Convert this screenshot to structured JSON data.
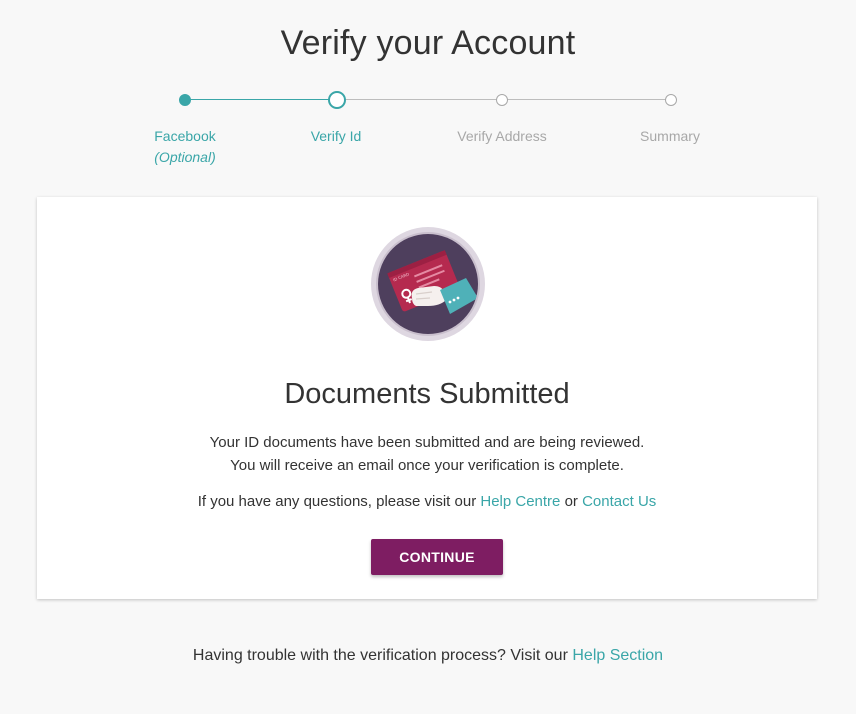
{
  "page": {
    "title": "Verify your Account"
  },
  "stepper": {
    "steps": [
      {
        "label": "Facebook",
        "sublabel": "(Optional)",
        "state": "complete"
      },
      {
        "label": "Verify Id",
        "state": "current"
      },
      {
        "label": "Verify Address",
        "state": "pending"
      },
      {
        "label": "Summary",
        "state": "pending"
      }
    ]
  },
  "card": {
    "illustration_icon": "id-card-in-hand-icon",
    "illustration_card_text": "ID CARD",
    "title": "Documents Submitted",
    "message_line1": "Your ID documents have been submitted and are being reviewed.",
    "message_line2": "You will receive an email once your verification is complete.",
    "help_prefix": "If you have any questions, please visit our",
    "help_centre_link": "Help Centre",
    "help_or": "or",
    "contact_us_link": "Contact Us",
    "continue_label": "CONTINUE"
  },
  "footer": {
    "text": "Having trouble with the verification process? Visit our",
    "help_section_link": "Help Section"
  },
  "colors": {
    "accent": "#3aa6a8",
    "primary_button": "#7e1d62",
    "inactive": "#a8a8a8",
    "illustration_bg": "#4e3f5d",
    "card_red": "#b52a4f"
  }
}
